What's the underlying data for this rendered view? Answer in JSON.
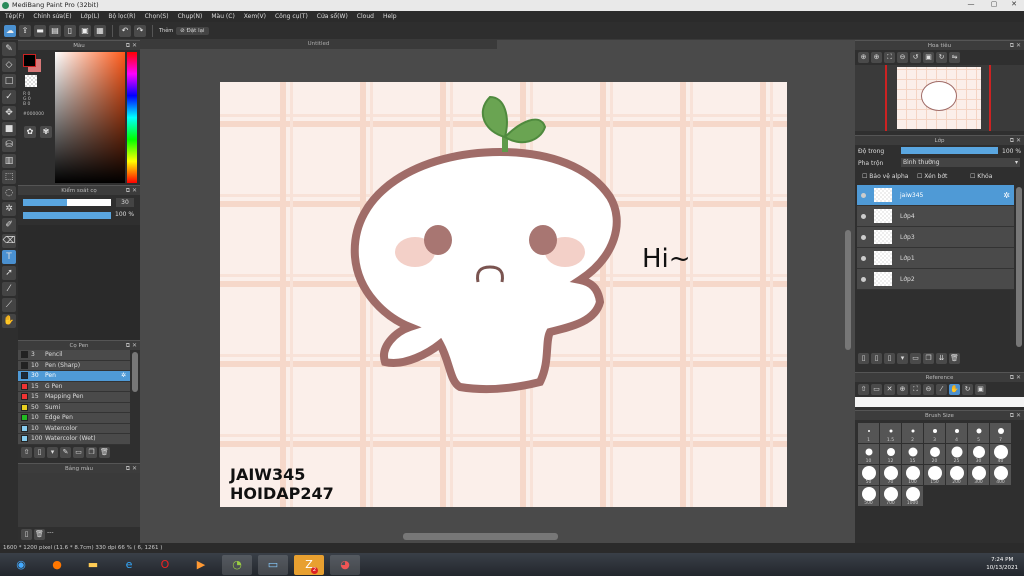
{
  "window": {
    "title": "MediBang Paint Pro (32bit)",
    "minimize": "—",
    "maximize": "▢",
    "close": "✕"
  },
  "menu": [
    "Tệp(F)",
    "Chỉnh sửa(E)",
    "Lớp(L)",
    "Bộ lọc(R)",
    "Chọn(S)",
    "Chụp(N)",
    "Màu (C)",
    "Xem(V)",
    "Công cụ(T)",
    "Cửa sổ(W)",
    "Cloud",
    "Help"
  ],
  "toolbar": {
    "snap_label": "Thẻm",
    "reset_label": "Đặt lại"
  },
  "color_panel": {
    "title": "Màu",
    "r": "R 0",
    "g": "G 0",
    "b": "B 0",
    "hex": "#000000",
    "accent": "#ff5a1a"
  },
  "brush_panel": {
    "title": "Kiểm soát cọ",
    "size": "30",
    "size_fraction": 0.5,
    "opacity": "100 %",
    "opacity_fraction": 1.0
  },
  "pen_panel": {
    "title": "Cọ Pen",
    "items": [
      {
        "size": "3",
        "name": "Pencil",
        "color": "#222222"
      },
      {
        "size": "10",
        "name": "Pen (Sharp)",
        "color": "#222222"
      },
      {
        "size": "30",
        "name": "Pen",
        "color": "#1a2a3a",
        "selected": true
      },
      {
        "size": "15",
        "name": "G Pen",
        "color": "#ee3333"
      },
      {
        "size": "15",
        "name": "Mapping Pen",
        "color": "#ee3333"
      },
      {
        "size": "50",
        "name": "Sumi",
        "color": "#e8d020"
      },
      {
        "size": "10",
        "name": "Edge Pen",
        "color": "#22bb22"
      },
      {
        "size": "10",
        "name": "Watercolor",
        "color": "#88ccee"
      },
      {
        "size": "100",
        "name": "Watercolor (Wet)",
        "color": "#88ccee"
      }
    ]
  },
  "palette_panel": {
    "title": "Bảng màu",
    "footer": "---"
  },
  "document": {
    "tab": "Untitled",
    "text_hi": "Hi~",
    "watermark_line1": "JAIW345",
    "watermark_line2": "HOIDAP247"
  },
  "navigator": {
    "title": "Hoa tiêu"
  },
  "layer_panel": {
    "title": "Lớp",
    "opacity_label": "Độ trong",
    "opacity": "100 %",
    "blend_label": "Pha trộn",
    "blend": "Bình thường",
    "protect_alpha": "Bảo vệ alpha",
    "clipping": "Xén bớt",
    "lock": "Khóa",
    "layers": [
      {
        "name": "jaiw345",
        "selected": true
      },
      {
        "name": "Lớp4"
      },
      {
        "name": "Lớp3"
      },
      {
        "name": "Lớp1"
      },
      {
        "name": "Lớp2"
      }
    ]
  },
  "reference_panel": {
    "title": "Reference"
  },
  "brush_size_panel": {
    "title": "Brush Size",
    "sizes": [
      "1",
      "1.5",
      "2",
      "3",
      "4",
      "5",
      "7",
      "10",
      "12",
      "15",
      "20",
      "25",
      "30",
      "40",
      "50",
      "70",
      "100",
      "150",
      "200",
      "300",
      "400",
      "500",
      "700",
      "1000"
    ]
  },
  "status": "1600 * 1200 pixel  (11.6 * 8.7cm)  330 dpi  66 %  ( 6, 1261 )",
  "clock": {
    "time": "7:24 PM",
    "date": "10/13/2021"
  },
  "taskbar": {
    "zalo_badge": "2"
  }
}
